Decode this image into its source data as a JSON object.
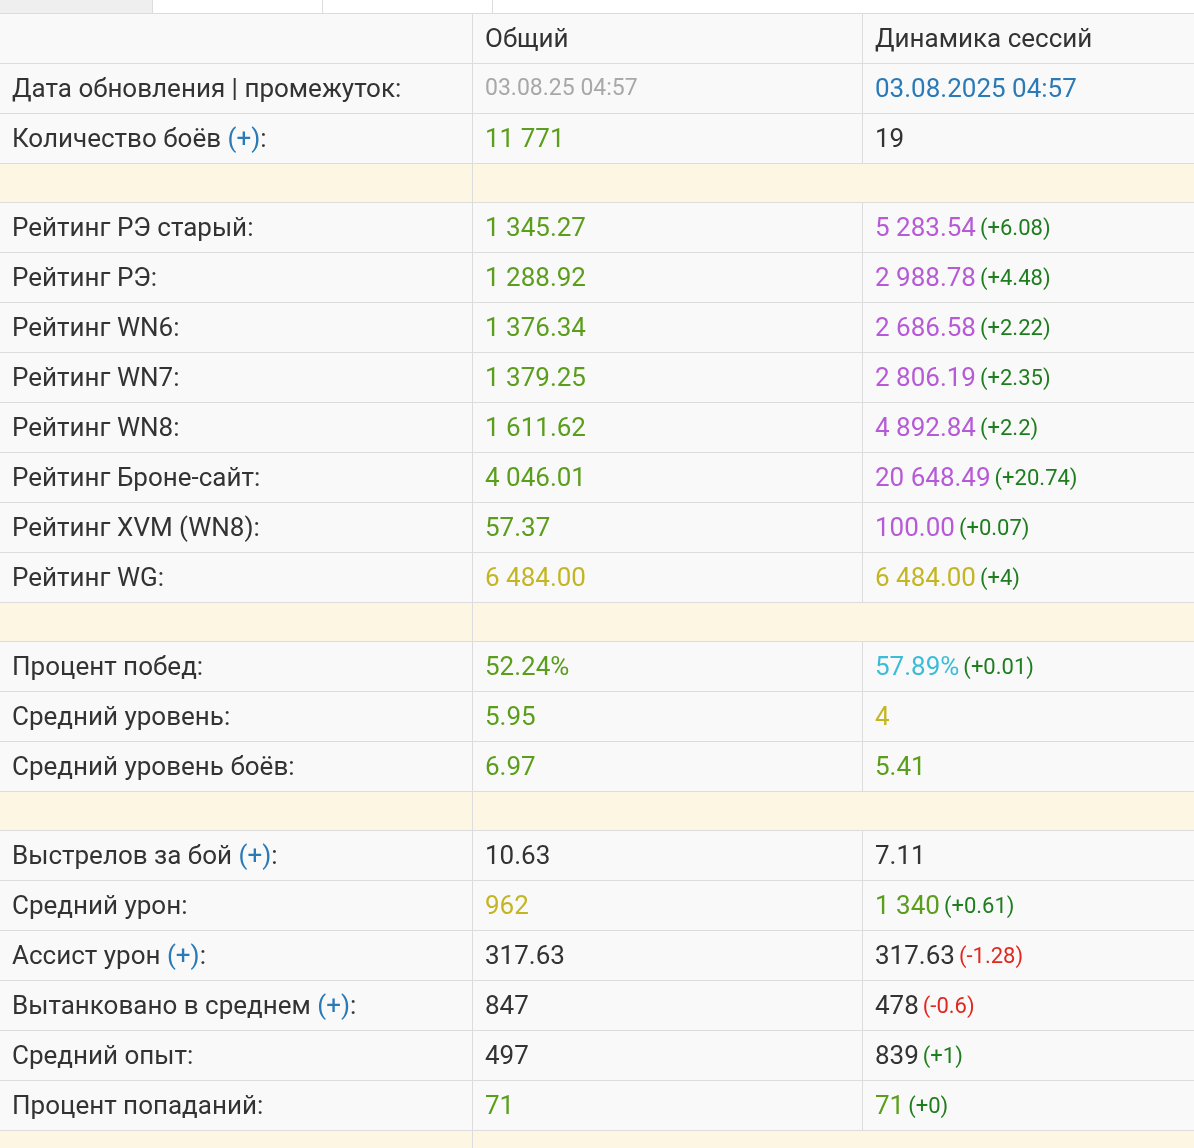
{
  "tabs": [
    {
      "selected": true
    },
    {
      "selected": false
    },
    {
      "selected": false
    }
  ],
  "table": {
    "columns": [
      "Общий",
      "Динамика сессий"
    ],
    "rows": [
      {
        "kind": "row",
        "label": {
          "text": "Дата обновления | промежуток:"
        },
        "values": [
          {
            "text": "03.08.25 04:57",
            "color": "#a8a8a8",
            "small": true
          },
          {
            "text": "03.08.2025 04:57",
            "color": "#2a7ab8"
          }
        ]
      },
      {
        "kind": "row",
        "label": {
          "text": "Количество боёв",
          "link": "(+)",
          "tail": ":"
        },
        "values": [
          {
            "text": "11 771",
            "color": "#5b9e1c"
          },
          {
            "text": "19",
            "color": "#333333"
          }
        ]
      },
      {
        "kind": "separator"
      },
      {
        "kind": "row",
        "label": {
          "text": "Рейтинг РЭ старый:"
        },
        "values": [
          {
            "text": "1 345.27",
            "color": "#5b9e1c"
          },
          {
            "text": "5 283.54",
            "color": "#b65ad8",
            "delta": {
              "text": "(+6.08)",
              "color": "#1e7d1e"
            }
          }
        ]
      },
      {
        "kind": "row",
        "label": {
          "text": "Рейтинг РЭ:"
        },
        "values": [
          {
            "text": "1 288.92",
            "color": "#5b9e1c"
          },
          {
            "text": "2 988.78",
            "color": "#b65ad8",
            "delta": {
              "text": "(+4.48)",
              "color": "#1e7d1e"
            }
          }
        ]
      },
      {
        "kind": "row",
        "label": {
          "text": "Рейтинг WN6:"
        },
        "values": [
          {
            "text": "1 376.34",
            "color": "#5b9e1c"
          },
          {
            "text": "2 686.58",
            "color": "#b65ad8",
            "delta": {
              "text": "(+2.22)",
              "color": "#1e7d1e"
            }
          }
        ]
      },
      {
        "kind": "row",
        "label": {
          "text": "Рейтинг WN7:"
        },
        "values": [
          {
            "text": "1 379.25",
            "color": "#5b9e1c"
          },
          {
            "text": "2 806.19",
            "color": "#b65ad8",
            "delta": {
              "text": "(+2.35)",
              "color": "#1e7d1e"
            }
          }
        ]
      },
      {
        "kind": "row",
        "label": {
          "text": "Рейтинг WN8:"
        },
        "values": [
          {
            "text": "1 611.62",
            "color": "#5b9e1c"
          },
          {
            "text": "4 892.84",
            "color": "#b65ad8",
            "delta": {
              "text": "(+2.2)",
              "color": "#1e7d1e"
            }
          }
        ]
      },
      {
        "kind": "row",
        "label": {
          "text": "Рейтинг Броне-сайт:"
        },
        "values": [
          {
            "text": "4 046.01",
            "color": "#5b9e1c"
          },
          {
            "text": "20 648.49",
            "color": "#b65ad8",
            "delta": {
              "text": "(+20.74)",
              "color": "#1e7d1e"
            }
          }
        ]
      },
      {
        "kind": "row",
        "label": {
          "text": "Рейтинг XVM (WN8):"
        },
        "values": [
          {
            "text": "57.37",
            "color": "#5b9e1c"
          },
          {
            "text": "100.00",
            "color": "#b65ad8",
            "delta": {
              "text": "(+0.07)",
              "color": "#1e7d1e"
            }
          }
        ]
      },
      {
        "kind": "row",
        "label": {
          "text": "Рейтинг WG:"
        },
        "values": [
          {
            "text": "6 484.00",
            "color": "#c4b622"
          },
          {
            "text": "6 484.00",
            "color": "#c4b622",
            "delta": {
              "text": "(+4)",
              "color": "#1e7d1e"
            }
          }
        ]
      },
      {
        "kind": "separator"
      },
      {
        "kind": "row",
        "label": {
          "text": "Процент побед:"
        },
        "values": [
          {
            "text": "52.24%",
            "color": "#5b9e1c"
          },
          {
            "text": "57.89%",
            "color": "#3dbcd8",
            "delta": {
              "text": "(+0.01)",
              "color": "#1e7d1e"
            }
          }
        ]
      },
      {
        "kind": "row",
        "label": {
          "text": "Средний уровень:"
        },
        "values": [
          {
            "text": "5.95",
            "color": "#5b9e1c"
          },
          {
            "text": "4",
            "color": "#c4b622"
          }
        ]
      },
      {
        "kind": "row",
        "label": {
          "text": "Средний уровень боёв:"
        },
        "values": [
          {
            "text": "6.97",
            "color": "#5b9e1c"
          },
          {
            "text": "5.41",
            "color": "#5b9e1c"
          }
        ]
      },
      {
        "kind": "separator"
      },
      {
        "kind": "row",
        "label": {
          "text": "Выстрелов за бой",
          "link": "(+)",
          "tail": ":"
        },
        "values": [
          {
            "text": "10.63",
            "color": "#333333"
          },
          {
            "text": "7.11",
            "color": "#333333"
          }
        ]
      },
      {
        "kind": "row",
        "label": {
          "text": "Средний урон:"
        },
        "values": [
          {
            "text": "962",
            "color": "#c4b622"
          },
          {
            "text": "1 340",
            "color": "#5b9e1c",
            "delta": {
              "text": "(+0.61)",
              "color": "#1e7d1e"
            }
          }
        ]
      },
      {
        "kind": "row",
        "label": {
          "text": "Ассист урон",
          "link": "(+)",
          "tail": ":"
        },
        "values": [
          {
            "text": "317.63",
            "color": "#333333"
          },
          {
            "text": "317.63",
            "color": "#333333",
            "delta": {
              "text": "(-1.28)",
              "color": "#e0281e"
            }
          }
        ]
      },
      {
        "kind": "row",
        "label": {
          "text": "Вытанковано в среднем",
          "link": "(+)",
          "tail": ":"
        },
        "values": [
          {
            "text": "847",
            "color": "#333333"
          },
          {
            "text": "478",
            "color": "#333333",
            "delta": {
              "text": "(-0.6)",
              "color": "#e0281e"
            }
          }
        ]
      },
      {
        "kind": "row",
        "label": {
          "text": "Средний опыт:"
        },
        "values": [
          {
            "text": "497",
            "color": "#333333"
          },
          {
            "text": "839",
            "color": "#333333",
            "delta": {
              "text": "(+1)",
              "color": "#1e7d1e"
            }
          }
        ]
      },
      {
        "kind": "row",
        "label": {
          "text": "Процент попаданий:"
        },
        "values": [
          {
            "text": "71",
            "color": "#5b9e1c"
          },
          {
            "text": "71",
            "color": "#5b9e1c",
            "delta": {
              "text": "(+0)",
              "color": "#1e7d1e"
            }
          }
        ]
      },
      {
        "kind": "separator"
      }
    ]
  }
}
